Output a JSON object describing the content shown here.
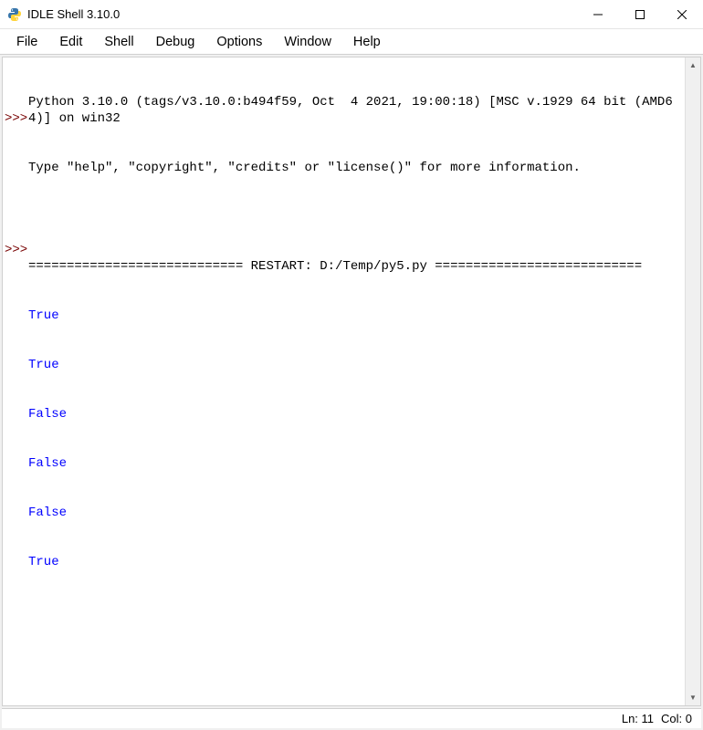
{
  "title": "IDLE Shell 3.10.0",
  "menus": {
    "file": "File",
    "edit": "Edit",
    "shell": "Shell",
    "debug": "Debug",
    "options": "Options",
    "window": "Window",
    "help": "Help"
  },
  "prompt": ">>>",
  "banner": {
    "line1": "Python 3.10.0 (tags/v3.10.0:b494f59, Oct  4 2021, 19:00:18) [MSC v.1929 64 bit (AMD64)] on win32",
    "line2": "Type \"help\", \"copyright\", \"credits\" or \"license()\" for more information."
  },
  "restart_line": "============================ RESTART: D:/Temp/py5.py ===========================",
  "output": [
    "True",
    "True",
    "False",
    "False",
    "False",
    "True"
  ],
  "status": {
    "ln": "Ln: 11",
    "col": "Col: 0"
  }
}
